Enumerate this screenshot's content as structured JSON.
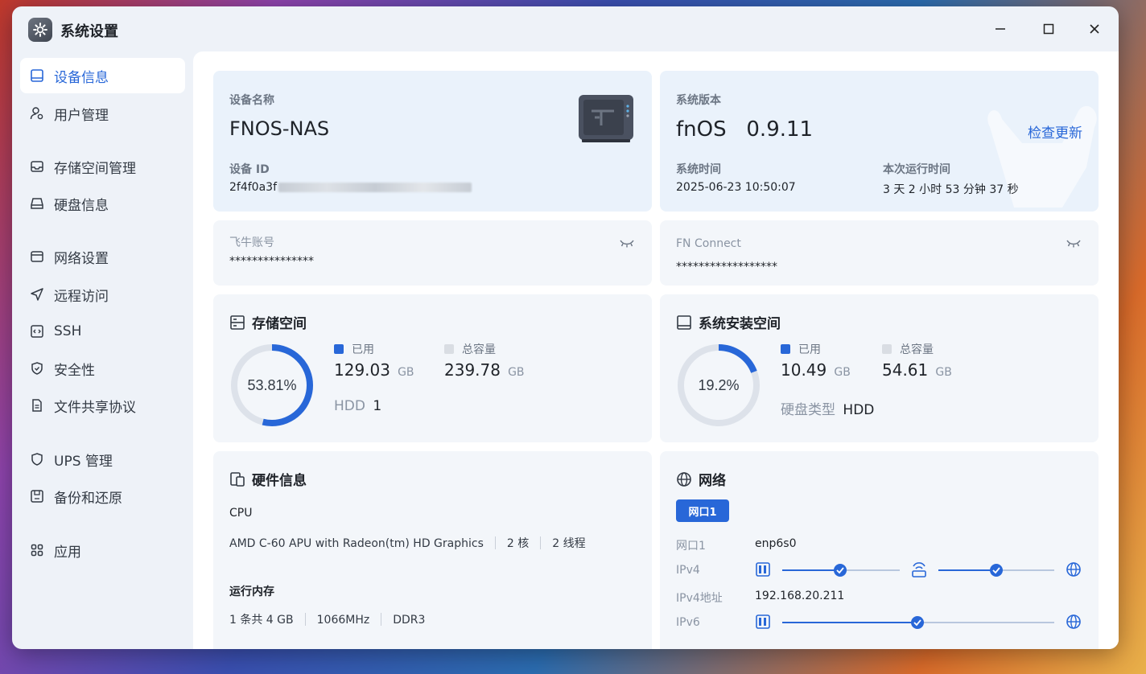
{
  "window": {
    "title": "系统设置"
  },
  "sidebar": {
    "items": [
      {
        "label": "设备信息",
        "active": true
      },
      {
        "label": "用户管理"
      },
      {
        "label": "存储空间管理"
      },
      {
        "label": "硬盘信息"
      },
      {
        "label": "网络设置"
      },
      {
        "label": "远程访问"
      },
      {
        "label": "SSH"
      },
      {
        "label": "安全性"
      },
      {
        "label": "文件共享协议"
      },
      {
        "label": "UPS 管理"
      },
      {
        "label": "备份和还原"
      },
      {
        "label": "应用"
      }
    ]
  },
  "device": {
    "name_label": "设备名称",
    "name": "FNOS-NAS",
    "id_label": "设备 ID",
    "id_prefix": "2f4f0a3f"
  },
  "system": {
    "version_label": "系统版本",
    "version": "fnOS   0.9.11",
    "check_update": "检查更新",
    "time_label": "系统时间",
    "time": "2025-06-23 10:50:07",
    "uptime_label": "本次运行时间",
    "uptime": "3 天 2 小时 53 分钟 37 秒"
  },
  "account": {
    "label": "飞牛账号",
    "value": "***************"
  },
  "fn_connect": {
    "label": "FN Connect",
    "value": "******************"
  },
  "storage": {
    "title": "存储空间",
    "percent": "53.81%",
    "ratio": 0.5381,
    "used_label": "已用",
    "used_value": "129.03",
    "used_unit": "GB",
    "total_label": "总容量",
    "total_value": "239.78",
    "total_unit": "GB",
    "disk_type": "HDD",
    "disk_count": "1"
  },
  "system_install": {
    "title": "系统安装空间",
    "percent": "19.2%",
    "ratio": 0.192,
    "used_label": "已用",
    "used_value": "10.49",
    "used_unit": "GB",
    "total_label": "总容量",
    "total_value": "54.61",
    "total_unit": "GB",
    "disk_type_label": "硬盘类型",
    "disk_type": "HDD"
  },
  "hardware": {
    "title": "硬件信息",
    "cpu_label": "CPU",
    "cpu_model": "AMD C-60 APU with Radeon(tm) HD Graphics",
    "cpu_cores": "2 核",
    "cpu_threads": "2 线程",
    "memory_label": "运行内存",
    "memory_size": "1 条共 4 GB",
    "memory_freq": "1066MHz",
    "memory_type": "DDR3"
  },
  "network": {
    "title": "网络",
    "tab": "网口1",
    "port_label": "网口1",
    "port_value": "enp6s0",
    "ipv4_label": "IPv4",
    "ipv4_addr_label": "IPv4地址",
    "ipv4_addr": "192.168.20.211",
    "ipv6_label": "IPv6"
  },
  "colors": {
    "accent": "#2867d8",
    "ring_bg": "#dde2ea",
    "legend_used": "#2867d8",
    "legend_total": "#d9dde3"
  }
}
